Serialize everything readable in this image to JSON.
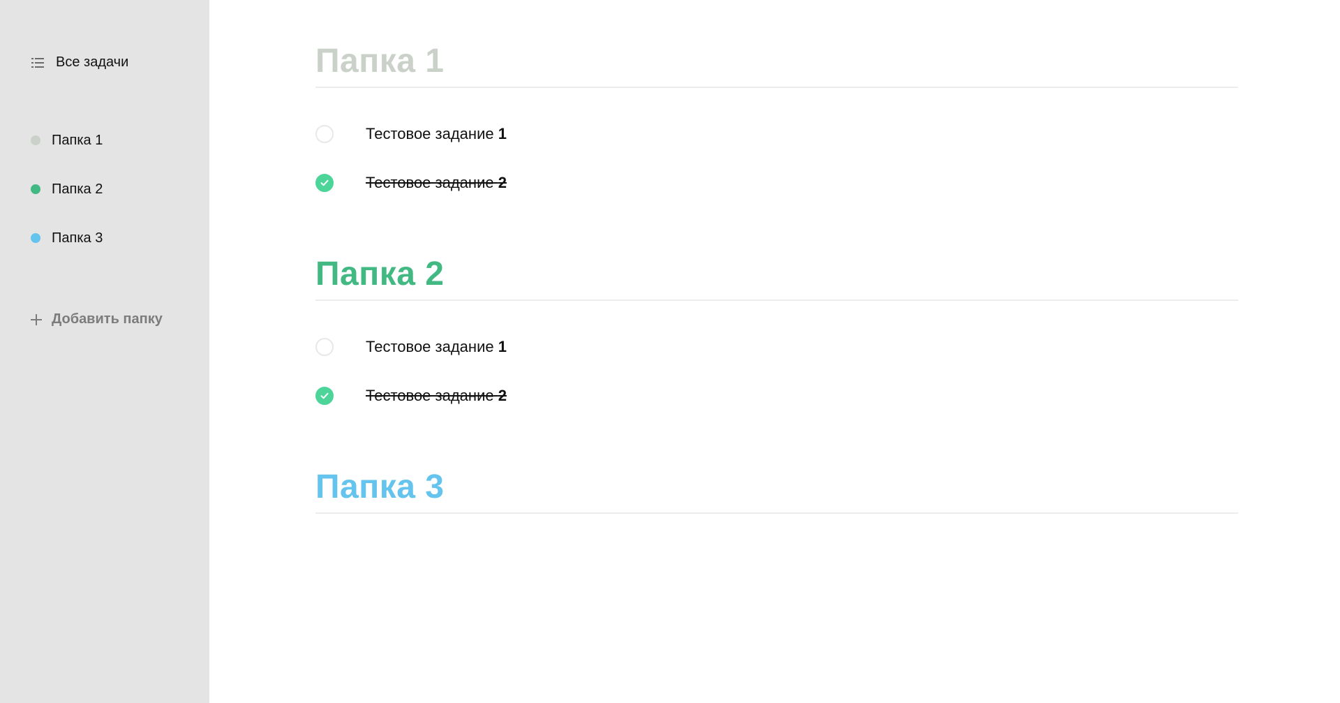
{
  "sidebar": {
    "all_tasks": {
      "label": "Все задачи",
      "icon": "list-icon"
    },
    "folders": [
      {
        "label": "Папка 1",
        "color": "#c9d1c8"
      },
      {
        "label": "Папка 2",
        "color": "#42b883"
      },
      {
        "label": "Папка 3",
        "color": "#64c4ed"
      }
    ],
    "add_folder": {
      "label": "Добавить папку",
      "icon": "plus-icon"
    }
  },
  "sections": [
    {
      "title": "Папка 1",
      "color": "#c9d1c8",
      "tasks": [
        {
          "text": "Тестовое задание",
          "num": "1",
          "completed": false
        },
        {
          "text": "Тестовое задание",
          "num": "2",
          "completed": true
        }
      ]
    },
    {
      "title": "Папка 2",
      "color": "#42b883",
      "tasks": [
        {
          "text": "Тестовое задание",
          "num": "1",
          "completed": false
        },
        {
          "text": "Тестовое задание",
          "num": "2",
          "completed": true
        }
      ]
    },
    {
      "title": "Папка 3",
      "color": "#64c4ed",
      "tasks": []
    }
  ],
  "colors": {
    "sidebar_bg": "#e4e4e4",
    "check_done": "#4dd599",
    "check_border": "#e8e8e8"
  }
}
